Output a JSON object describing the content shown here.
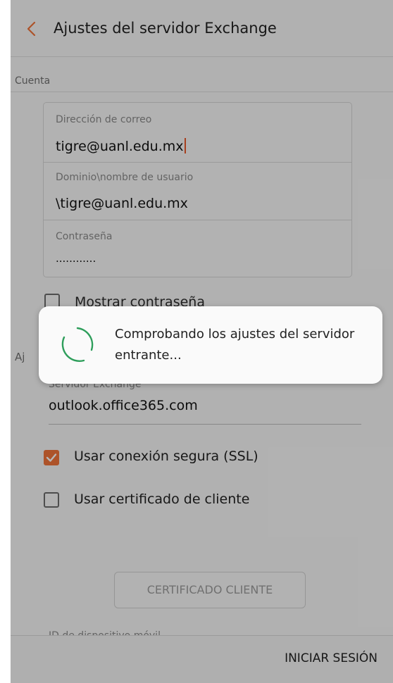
{
  "header": {
    "title": "Ajustes del servidor Exchange"
  },
  "sections": {
    "account": "Cuenta",
    "server_prefix": "Aj"
  },
  "account": {
    "email_label": "Dirección de correo",
    "email_value": "tigre@uanl.edu.mx",
    "domain_label": "Dominio\\nombre de usuario",
    "domain_value": "\\tigre@uanl.edu.mx",
    "password_label": "Contraseña",
    "password_value": "............",
    "show_password_label": "Mostrar contraseña"
  },
  "server": {
    "label": "Servidor Exchange",
    "value": "outlook.office365.com"
  },
  "options": {
    "ssl_label": "Usar conexión segura (SSL)",
    "ssl_checked": true,
    "client_cert_label": "Usar certificado de cliente",
    "client_cert_checked": false
  },
  "cert_button_label": "CERTIFICADO CLIENTE",
  "device_id_label": "ID de dispositivo móvil",
  "bottom": {
    "signin_label": "INICIAR SESIÓN"
  },
  "dialog": {
    "message": "Comprobando los ajustes del servidor entrante..."
  },
  "colors": {
    "accent": "#f0743a",
    "spinner": "#2e9e5b",
    "caret": "#e8582a"
  },
  "icons": {
    "back": "chevron-left-icon",
    "spinner": "loading-spinner-icon",
    "check": "check-icon"
  }
}
